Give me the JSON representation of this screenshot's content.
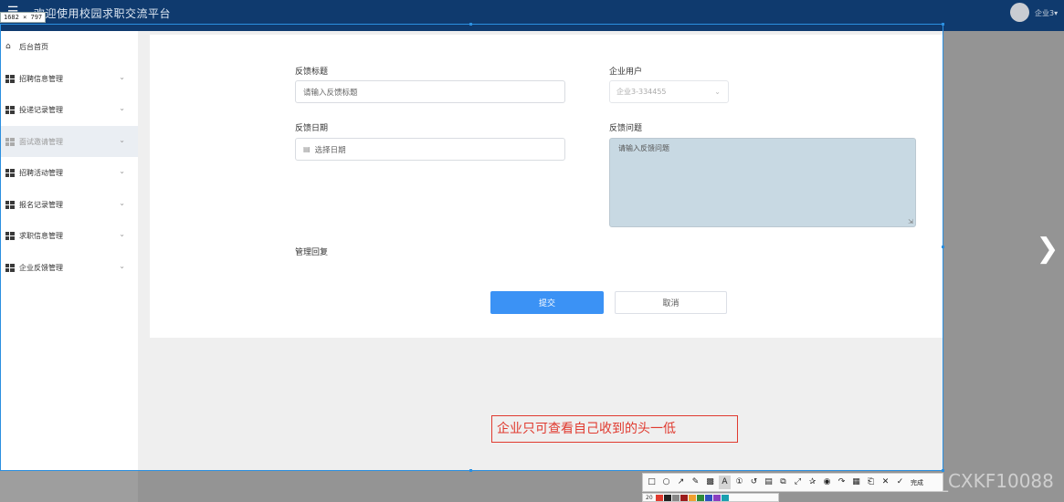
{
  "header": {
    "title": "欢迎使用校园求职交流平台",
    "user": "企业3"
  },
  "dimension_badge": "1682 × 797",
  "sidebar": {
    "items": [
      {
        "label": "后台首页",
        "icon": "home-icon"
      },
      {
        "label": "招聘信息管理",
        "icon": "grid-icon"
      },
      {
        "label": "投递记录管理",
        "icon": "grid-icon"
      },
      {
        "label": "面试邀请管理",
        "icon": "grid-icon"
      },
      {
        "label": "招聘活动管理",
        "icon": "grid-icon"
      },
      {
        "label": "报名记录管理",
        "icon": "grid-icon"
      },
      {
        "label": "求职信息管理",
        "icon": "grid-icon"
      },
      {
        "label": "企业反馈管理",
        "icon": "grid-icon"
      }
    ]
  },
  "form": {
    "feedback_title": {
      "label": "反馈标题",
      "placeholder": "请输入反馈标题"
    },
    "company_user": {
      "label": "企业用户",
      "value": "企业3-334455"
    },
    "feedback_date": {
      "label": "反馈日期",
      "placeholder": "选择日期"
    },
    "feedback_question": {
      "label": "反馈问题",
      "placeholder": "请输入反馈问题"
    },
    "admin_reply": {
      "label": "管理回复"
    },
    "submit_label": "提交",
    "cancel_label": "取消"
  },
  "annotation_text": "企业只可查看自己收到的头一低",
  "watermark": "CSDN @AI_CXKF10088",
  "toolbar": {
    "finish_label": "完成",
    "font_size": "20"
  },
  "colors": {
    "header_bg": "#0f3a6e",
    "primary": "#3b92f5",
    "annotation": "#e03a2f",
    "selection": "#2b8fe0"
  }
}
